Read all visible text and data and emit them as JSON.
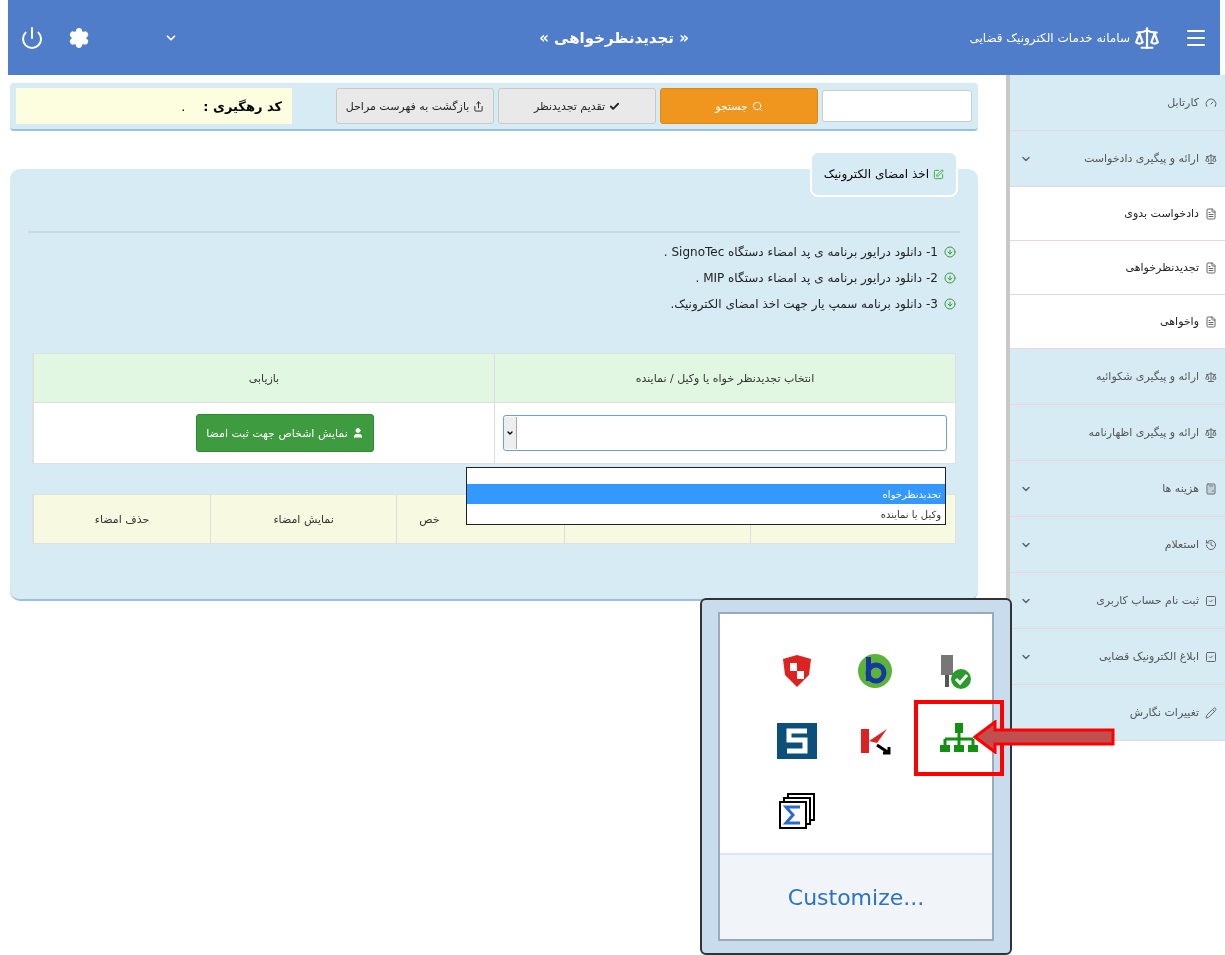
{
  "header": {
    "app_title": "سامانه خدمات الکترونیک قضایی",
    "page_title": "« تجدیدنظرخواهی »"
  },
  "toolbar": {
    "search_button": "جستجو",
    "submit_button": "تقدیم تجدیدنظر",
    "back_button": "بازگشت به فهرست مراحل",
    "tracking_label": "کد رهگیری :",
    "tracking_value": "."
  },
  "panel": {
    "tab_label": "اخذ امضای الکترونیک",
    "downloads": [
      "1- دانلود درایور برنامه ی پد امضاء دستگاه SignoTec .",
      "2- دانلود درایور برنامه ی پد امضاء دستگاه MIP .",
      "3- دانلود برنامه سمپ یار جهت اخذ امضای الکترونیک."
    ],
    "select_table": {
      "columns": [
        "انتخاب تجدیدنظر خواه یا وکیل / نماینده",
        "بازیابی"
      ],
      "show_button": "نمایش اشخاص جهت ثبت امضا"
    },
    "dropdown": {
      "options": [
        {
          "label": "تجدیدنظرخواه",
          "selected": true
        },
        {
          "label": "وکیل یا نماینده",
          "selected": false
        }
      ]
    },
    "signatures_table": {
      "columns": [
        "",
        "",
        "خص",
        "نمایش امضاء",
        "حذف امضاء"
      ]
    }
  },
  "sidebar": {
    "items": [
      {
        "label": "کارتابل",
        "kind": "dashboard",
        "submenu": false
      },
      {
        "label": "ارائه و پیگیری دادخواست",
        "kind": "scales",
        "submenu": true,
        "children": [
          {
            "label": "دادخواست بدوی"
          },
          {
            "label": "تجدیدنظرخواهی"
          },
          {
            "label": "واخواهی"
          }
        ]
      },
      {
        "label": "ارائه و پیگیری شکوائیه",
        "kind": "scales",
        "submenu": false
      },
      {
        "label": "ارائه و پیگیری اظهارنامه",
        "kind": "scales",
        "submenu": false
      },
      {
        "label": "هزینه ها",
        "kind": "calculator",
        "submenu": true
      },
      {
        "label": "استعلام",
        "kind": "history",
        "submenu": true
      },
      {
        "label": "ثبت نام حساب کاربری",
        "kind": "check",
        "submenu": true
      },
      {
        "label": "ابلاغ الکترونیک قضایی",
        "kind": "check",
        "submenu": true
      },
      {
        "label": "تغییرات نگارش",
        "kind": "pencil",
        "submenu": false
      }
    ]
  },
  "tray": {
    "icons": [
      {
        "kind": "shield",
        "highlighted": false
      },
      {
        "kind": "globe",
        "highlighted": false
      },
      {
        "kind": "plug",
        "highlighted": false
      },
      {
        "kind": "s-logo",
        "highlighted": false
      },
      {
        "kind": "k-logo",
        "highlighted": false
      },
      {
        "kind": "network",
        "highlighted": true
      },
      {
        "kind": "sigma",
        "highlighted": false
      }
    ],
    "customize_link": "Customize..."
  }
}
